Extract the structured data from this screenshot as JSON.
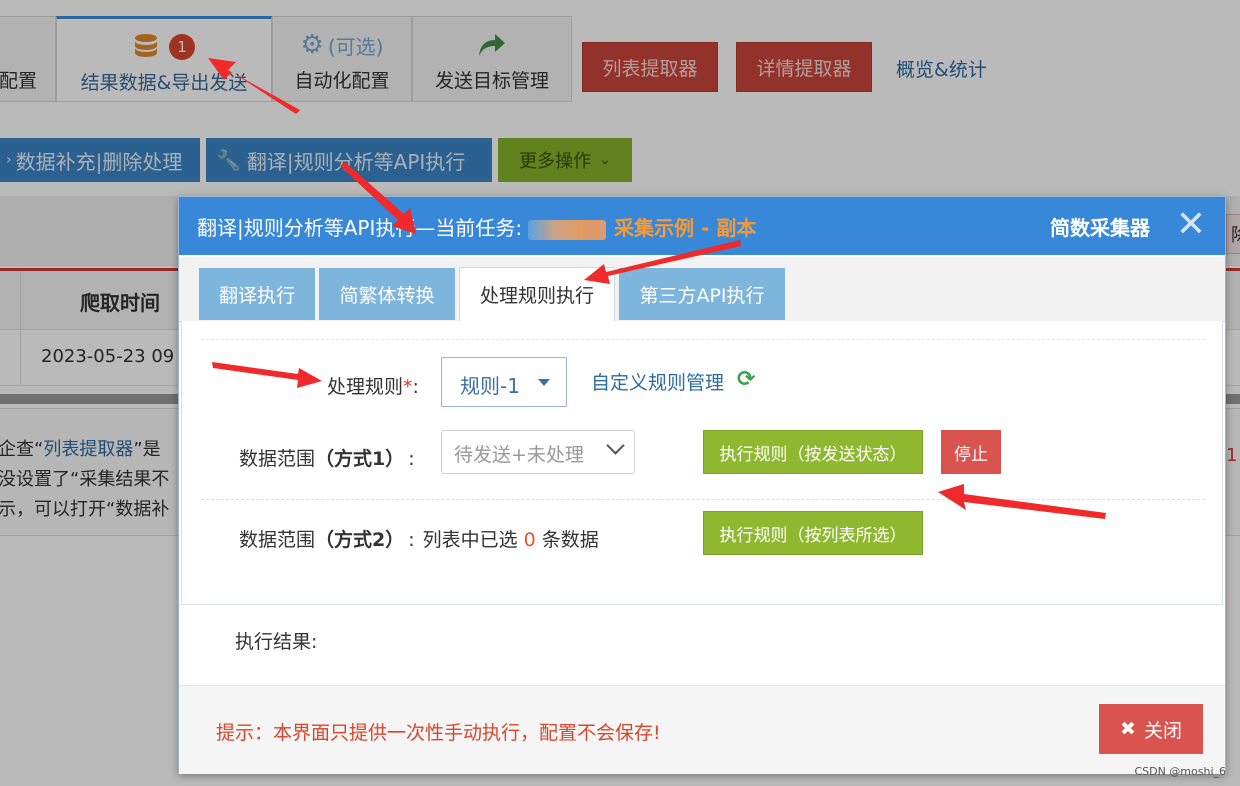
{
  "background": {
    "nav_tabs": [
      {
        "label": "配置",
        "icon": null
      },
      {
        "label": "结果数据&导出发送",
        "icon": "database-icon",
        "badge": "1"
      },
      {
        "label": "自动化配置",
        "icon": "gears-icon",
        "icon_text": "(可选)"
      },
      {
        "label": "发送目标管理",
        "icon": "share-arrow-icon"
      }
    ],
    "buttons": {
      "list_extractor": "列表提取器",
      "detail_extractor": "详情提取器",
      "overview": "概览&统计",
      "supplement": "数据补充|删除处理",
      "translate_api": "翻译|规则分析等API执行",
      "more": "更多操作"
    },
    "table": {
      "header": "爬取时间",
      "row_time": "2023-05-23 09",
      "right_button": "除("
    },
    "notice": {
      "line1_prefix": "企查“",
      "line1_link": "列表提取器",
      "line1_suffix": "”是",
      "line2": "没设置了“采集结果不",
      "line3": "示，可以打开“数据补",
      "right_mark": "1"
    }
  },
  "modal": {
    "title_prefix": "翻译|规则分析等API执行—当前任务:",
    "task_name": "采集示例 - 副本",
    "brand": "简数采集器",
    "tabs": [
      "翻译执行",
      "简繁体转换",
      "处理规则执行",
      "第三方API执行"
    ],
    "active_tab": 2,
    "rule_label": "处理规则",
    "required_mark": "*",
    "colon": ":",
    "rule_value": "规则-1",
    "custom_rule_link": "自定义规则管理",
    "range1_label": "数据范围",
    "range1_method": "（方式1）",
    "range1_value": "待发送+未处理",
    "exec_by_status": "执行规则（按发送状态）",
    "stop": "停止",
    "range2_label": "数据范围",
    "range2_method": "（方式2）",
    "range2_prefix": "列表中已选",
    "selected_count": "0",
    "range2_suffix": "条数据",
    "exec_by_selection": "执行规则（按列表所选）",
    "result_label": "执行结果:",
    "tip": "提示：本界面只提供一次性手动执行，配置不会保存!",
    "close_label": "关闭"
  },
  "watermark": "CSDN @moshi_6",
  "colors": {
    "header_blue": "#3788d8",
    "tab_blue": "#7eb5dc",
    "exec_green": "#8fb830",
    "danger_red": "#d9534f",
    "task_orange": "#f79a36"
  }
}
